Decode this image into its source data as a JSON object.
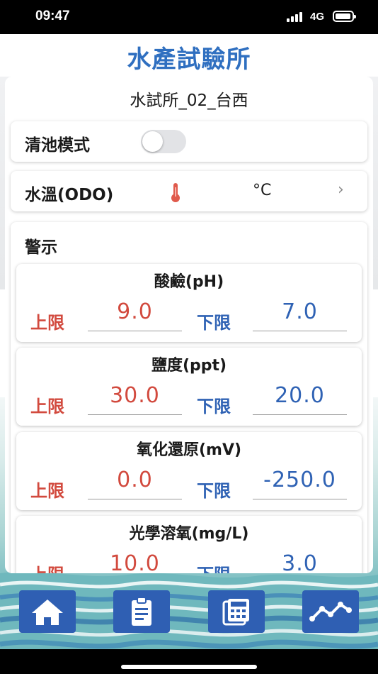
{
  "status_bar": {
    "time": "09:47",
    "network": "4G"
  },
  "header": {
    "title": "水產試驗所"
  },
  "device": {
    "name": "水試所_02_台西"
  },
  "clean_mode": {
    "label": "清池模式",
    "enabled": false
  },
  "temperature": {
    "label": "水溫(ODO)",
    "unit": "°C"
  },
  "alerts": {
    "title": "警示",
    "upper_label": "上限",
    "lower_label": "下限",
    "params": [
      {
        "name": "酸鹼(pH)",
        "upper": "9.0",
        "lower": "7.0"
      },
      {
        "name": "鹽度(ppt)",
        "upper": "30.0",
        "lower": "20.0"
      },
      {
        "name": "氧化還原(mV)",
        "upper": "0.0",
        "lower": "-250.0"
      },
      {
        "name": "光學溶氧(mg/L)",
        "upper": "10.0",
        "lower": "3.0"
      }
    ]
  },
  "nav": {
    "items": [
      {
        "icon": "home-icon"
      },
      {
        "icon": "clipboard-icon"
      },
      {
        "icon": "calculator-icon"
      },
      {
        "icon": "chart-line-icon"
      }
    ]
  },
  "colors": {
    "accent_blue": "#2f6fc0",
    "nav_blue": "#2f5fb3",
    "upper_red": "#d24a3e",
    "lower_blue": "#2f62b4"
  }
}
